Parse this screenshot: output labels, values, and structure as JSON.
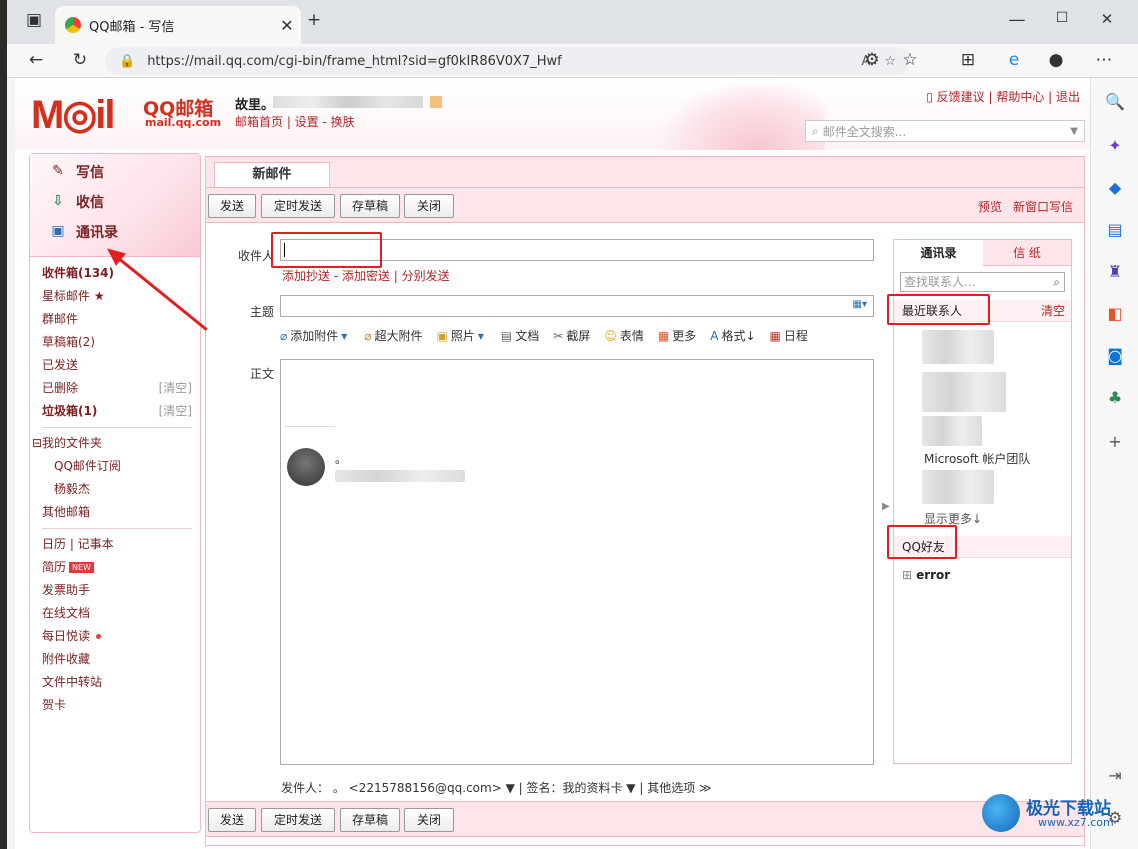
{
  "browser": {
    "tab_title": "QQ邮箱 - 写信",
    "tab_close": "✕",
    "new_tab": "+",
    "url": "https://mail.qq.com/cgi-bin/frame_html?sid=gf0kIR86V0X7_Hwf",
    "window_min": "—",
    "window_max": "☐",
    "window_close": "✕"
  },
  "header": {
    "logo": "M◎il",
    "logo_name": "QQ邮箱",
    "logo_sub": "mail.qq.com",
    "user_name": "故里。",
    "user_links": "邮箱首页 | 设置 - 换肤",
    "top_links": "反馈建议 | 帮助中心 | 退出",
    "search_placeholder": "邮件全文搜索..."
  },
  "left": {
    "write": "写信",
    "inbox_btn": "收信",
    "contacts_btn": "通讯录",
    "items": [
      {
        "label": "收件箱(134)",
        "bold": true
      },
      {
        "label": "星标邮件 ★"
      },
      {
        "label": "群邮件"
      },
      {
        "label": "草稿箱(2)"
      },
      {
        "label": "已发送"
      },
      {
        "label": "已删除",
        "right": "[清空]"
      },
      {
        "label": "垃圾箱(1)",
        "bold": true,
        "right": "[清空]"
      }
    ],
    "folders_title": "⊟我的文件夹",
    "folders": [
      "QQ邮件订阅",
      "杨毅杰"
    ],
    "other_mailbox": "其他邮箱",
    "tools": [
      "日历 | 记事本",
      "简历",
      "发票助手",
      "在线文档",
      "每日悦读",
      "附件收藏",
      "文件中转站",
      "贺卡"
    ],
    "new_badge": "NEW"
  },
  "compose": {
    "tab": "新邮件",
    "buttons": {
      "send": "发送",
      "timed": "定时发送",
      "draft": "存草稿",
      "close": "关闭"
    },
    "preview": "预览",
    "new_window": "新窗口写信",
    "to_label": "收件人",
    "to_links": "添加抄送 - 添加密送 | 分别发送",
    "subject_label": "主题",
    "body_label": "正文",
    "tools": {
      "attach": "添加附件",
      "big_attach": "超大附件",
      "photo": "照片",
      "doc": "文档",
      "screenshot": "截屏",
      "emoji": "表情",
      "more": "更多",
      "format": "格式↓",
      "schedule": "日程"
    },
    "signature_dot": "。",
    "sender_line": "发件人：  。 <2215788156@qq.com> ▼   |   签名：我的资料卡 ▼   |   其他选项 ≫"
  },
  "contacts_panel": {
    "tab_contacts": "通讯录",
    "tab_paper": "信  纸",
    "search_placeholder": "查找联系人...",
    "recent": "最近联系人",
    "clear": "清空",
    "microsoft": "Microsoft 帐户团队",
    "show_more": "显示更多↓",
    "qq_friends": "QQ好友",
    "group": "error"
  },
  "watermark": {
    "text": "极光下载站",
    "url": "www.xz7.com"
  }
}
